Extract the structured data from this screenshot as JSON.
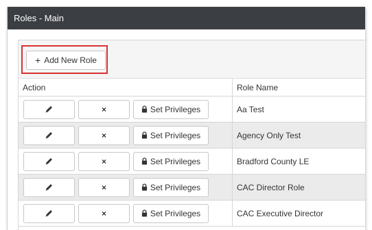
{
  "window": {
    "title": "Roles - Main"
  },
  "toolbar": {
    "add_icon": "+",
    "add_label": "Add New Role",
    "highlight_color": "#d93030"
  },
  "table": {
    "columns": {
      "action": "Action",
      "role_name": "Role Name"
    },
    "row_actions": {
      "edit_icon": "pencil-icon",
      "delete_icon": "×",
      "privileges_label": "Set Privileges"
    },
    "rows": [
      {
        "role_name": "Aa Test"
      },
      {
        "role_name": "Agency Only Test"
      },
      {
        "role_name": "Bradford County LE"
      },
      {
        "role_name": "CAC Director Role"
      },
      {
        "role_name": "CAC Executive Director"
      }
    ]
  }
}
